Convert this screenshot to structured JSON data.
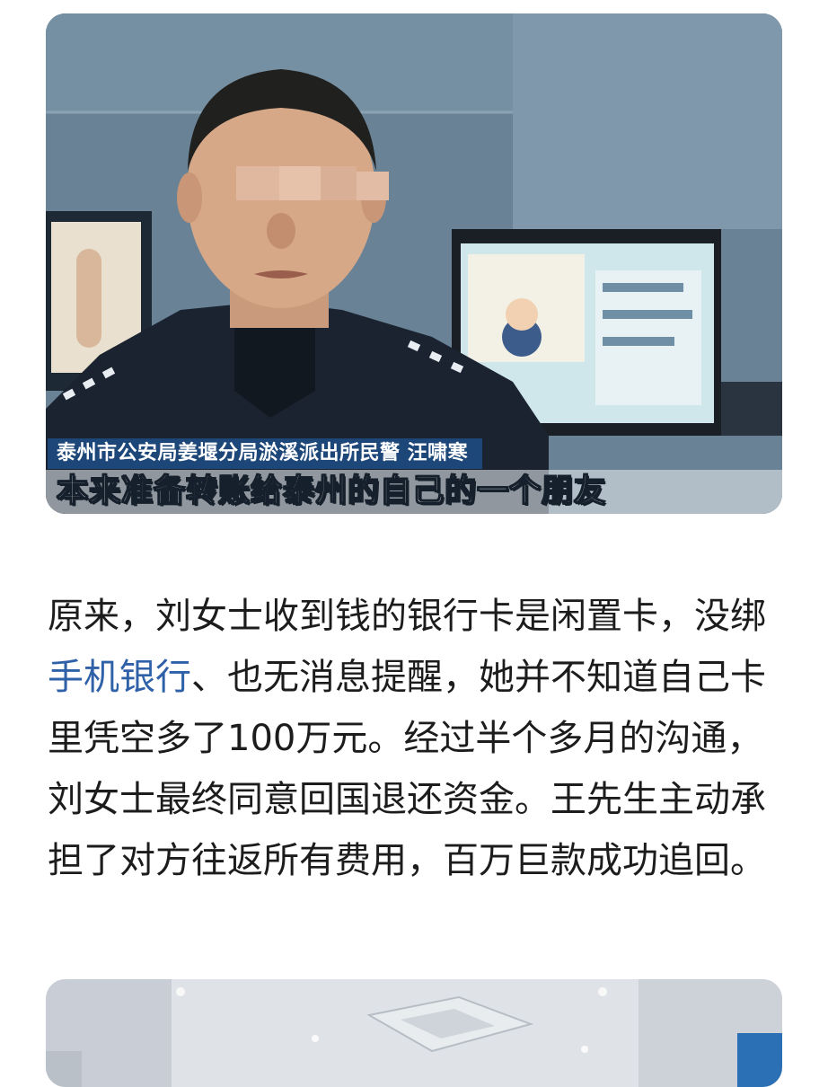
{
  "top_video": {
    "caption_name": "泰州市公安局姜堰分局淤溪派出所民警 汪啸寒",
    "caption_quote": "本来准备转账给泰州的自己的一个朋友"
  },
  "article": {
    "text_before_link": "原来，刘女士收到钱的银行卡是闲置卡，没绑",
    "link_text": "手机银行",
    "text_after_link": "、也无消息提醒，她并不知道自己卡里凭空多了100万元。经过半个多月的沟通，刘女士最终同意回国退还资金。王先生主动承担了对方往返所有费用，百万巨款成功追回。",
    "link_color": "#2f61a8"
  },
  "colors": {
    "caption_bar": "#1e4b82",
    "text": "#1c1c1c"
  }
}
